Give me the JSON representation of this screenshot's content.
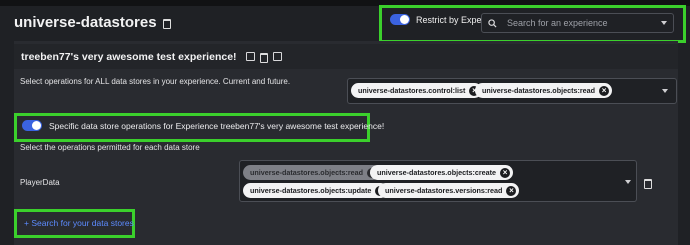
{
  "header": {
    "title": "universe-datastores",
    "restrict_label": "Restrict by Experience",
    "search_placeholder": "Search for an experience"
  },
  "experience": {
    "title": "treeben77's very awesome test experience!"
  },
  "all_ops": {
    "label": "Select operations for ALL data stores in your experience. Current and future.",
    "chips": [
      "universe-datastores.control:list",
      "universe-datastores.objects:read"
    ]
  },
  "specific": {
    "toggle_label": "Specific data store operations for Experience treeben77's very awesome test experience!",
    "select_label": "Select the operations permitted for each data store"
  },
  "datastore": {
    "name": "PlayerData",
    "chips": [
      "universe-datastores.objects:read",
      "universe-datastores.objects:create",
      "universe-datastores.objects:update",
      "universe-datastores.versions:read"
    ]
  },
  "add_link": "+ Search for your data stores",
  "colors": {
    "accent": "#3b63e0",
    "highlight_box": "#3bd02c",
    "link": "#5c8bff"
  }
}
